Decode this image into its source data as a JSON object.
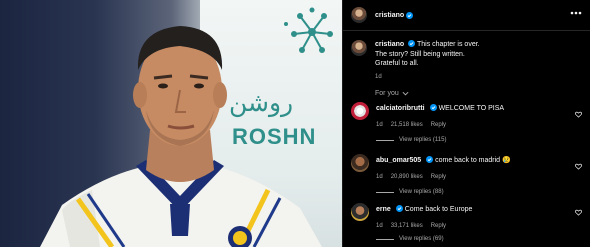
{
  "post": {
    "author": "cristiano",
    "caption": {
      "lines": [
        "This chapter is over.",
        "The story? Still being written.",
        "Grateful to all."
      ],
      "time": "1d"
    },
    "sponsor_arabic": "روشن",
    "sponsor_latin": "ROSHN"
  },
  "comments_section": {
    "sort_label": "For you",
    "comments": [
      {
        "username": "calciatoribrutti",
        "verified": true,
        "text": "WELCOME TO PISA",
        "time": "1d",
        "likes": "21,518 likes",
        "reply_label": "Reply",
        "view_replies": "View replies (115)"
      },
      {
        "username": "abu_omar505",
        "verified": true,
        "text": "come back to madrid 😢",
        "time": "1d",
        "likes": "20,890 likes",
        "reply_label": "Reply",
        "view_replies": "View replies (88)"
      },
      {
        "username": "erne",
        "verified": true,
        "text": "Come back to Europe",
        "time": "1d",
        "likes": "33,171 likes",
        "reply_label": "Reply",
        "view_replies": "View replies (69)"
      }
    ]
  },
  "icons": {
    "verified": "verified-badge-icon",
    "more": "more-options-icon",
    "heart": "heart-icon",
    "chevron": "chevron-down-icon"
  },
  "colors": {
    "verified_blue": "#0095f6",
    "secondary_text": "#a8a8a8",
    "sponsor_teal": "#2f8f8a"
  }
}
